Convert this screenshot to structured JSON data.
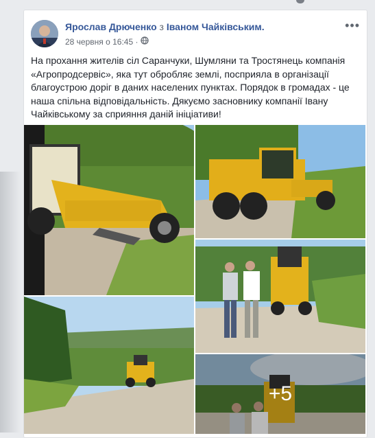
{
  "post": {
    "author": "Ярослав Дрюченко",
    "with_text": "з",
    "tagged": "Іваном Чайківським.",
    "timestamp": "28 червня о 16:45 ·",
    "privacy_icon": "globe-icon",
    "menu_icon": "more-options-icon",
    "text": "На прохання жителів сіл Саранчуки, Шумляни та Тростянець компанія «Агропродсервіс», яка тут обробляє землі, посприяла в організації благоустрою доріг в даних населених пунктах. Порядок в громадах - це наша спільна відповідальність. Дякуємо засновнику компанії Івану Чайківському за сприяння даній ініціативи!"
  },
  "photos": {
    "more_count": "+5"
  }
}
